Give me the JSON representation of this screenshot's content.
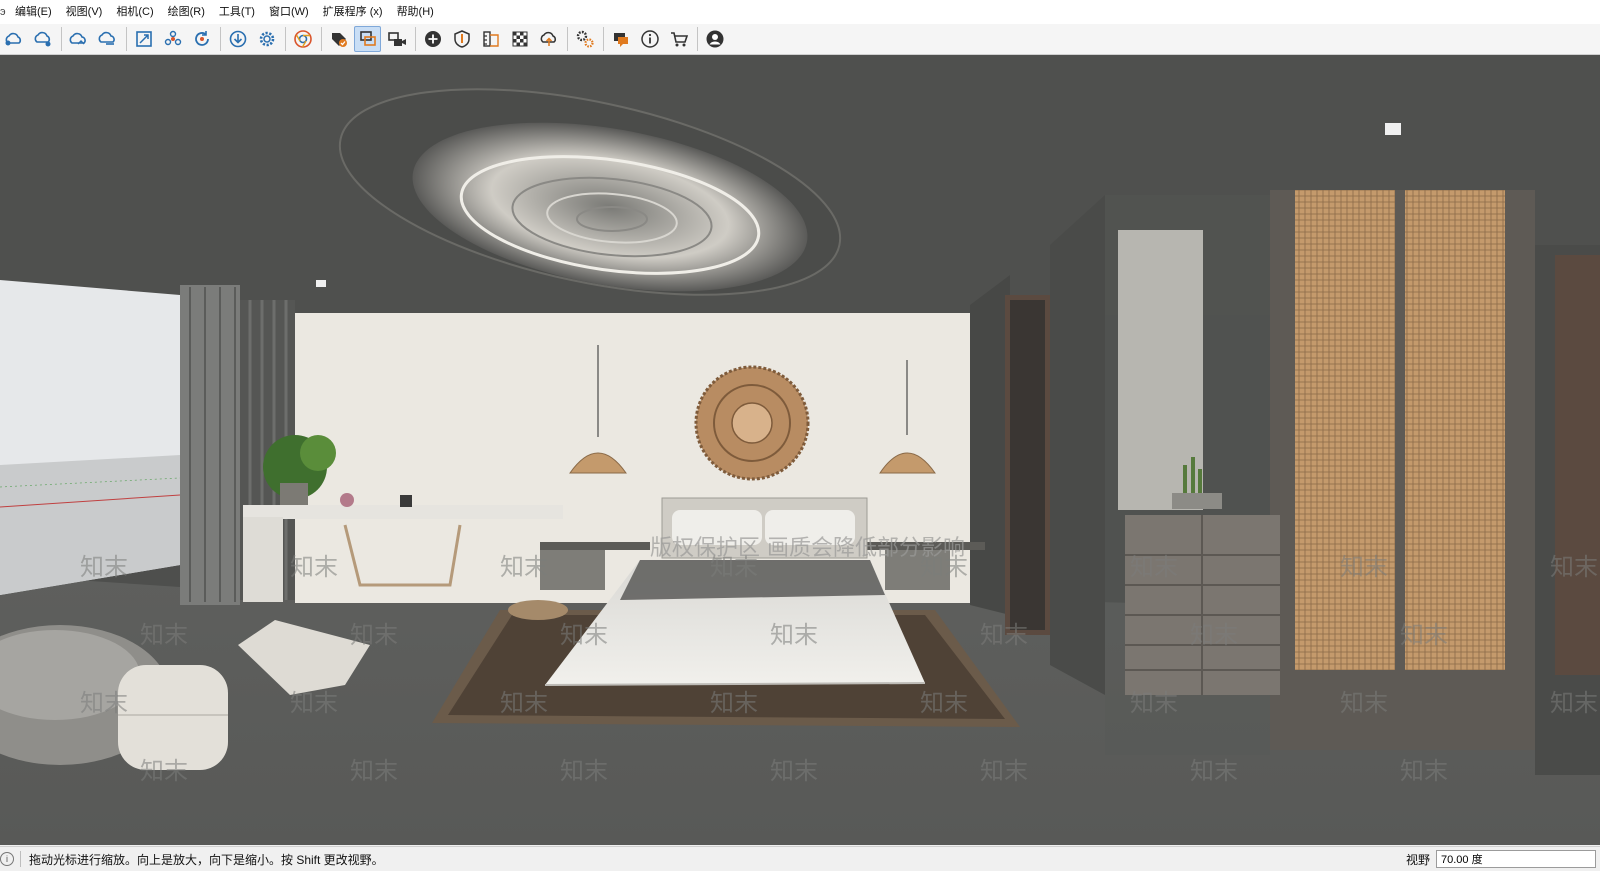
{
  "menu": {
    "edge_glyph": "э",
    "items": [
      "编辑(E)",
      "视图(V)",
      "相机(C)",
      "绘图(R)",
      "工具(T)",
      "窗口(W)",
      "扩展程序 (x)",
      "帮助(H)"
    ]
  },
  "toolbar": {
    "groups": [
      [
        "cloud-sync-icon",
        "cloud-share-icon"
      ],
      [
        "cloud-upload-icon",
        "cloud-download-icon"
      ],
      [
        "zoom-extents-icon",
        "components-icon",
        "refresh-icon"
      ],
      [
        "download-icon",
        "settings-gear-icon"
      ],
      [
        "chrome-icon"
      ],
      [
        "tag-check-icon",
        "outline-icon",
        "camera-record-icon"
      ],
      [
        "add-circle-icon",
        "shield-icon",
        "ruler-layers-icon",
        "checker-icon",
        "cloud-up-icon"
      ],
      [
        "extension-settings-icon"
      ],
      [
        "chat-icon",
        "info-icon",
        "cart-icon"
      ],
      [
        "account-icon"
      ]
    ],
    "active_icon": "outline-icon"
  },
  "viewport": {
    "watermark_text": "知末",
    "overlay_banner": "版权保护区 画质会降低部分影响"
  },
  "status": {
    "message": "拖动光标进行缩放。向上是放大，向下是缩小。按 Shift 更改视野。",
    "vcb_label": "视野",
    "vcb_value": "70.00 度"
  },
  "colors": {
    "wall_dark": "#4e4f4d",
    "feature_wall": "#ebe8e1",
    "rattan": "#c49a6c",
    "floor": "#595a58",
    "bed_linen": "#e6e5e1"
  }
}
